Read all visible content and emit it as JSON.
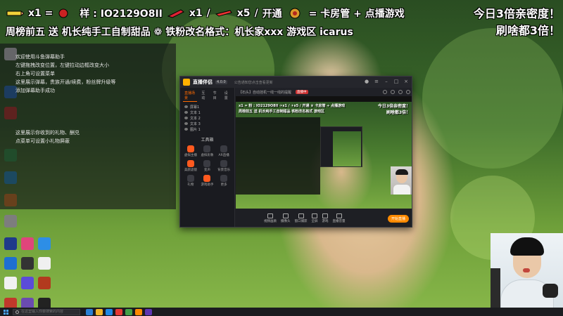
{
  "overlay": {
    "line1_prefix": "x1 = ",
    "line1_mid": "样 : IO2129O8II",
    "line1_x1": "x1",
    "line1_sep": "/",
    "line1_x5": "x5",
    "line1_sep2": "/",
    "line1_open": "开通",
    "line1_eq": "= 卡房管 + 点播游戏",
    "line2": "周榜前五 送 机长纯手工自制甜品 ❁ 铁粉改名格式：机长家xxx 游戏区 icarus"
  },
  "promo": {
    "line1": "今日3倍亲密度！",
    "line2": "刷啥都3倍！"
  },
  "chat_panel": {
    "lines": [
      "欢迎使用斗鱼弹幕助手",
      "左键拖拽改变位置，左键拉动边框改变大小",
      "右上角可设置菜单",
      "这里展示弹幕，贵族开通/续费，粉丝牌升级等",
      "添加弹幕助手成功",
      "这里展示你收到的礼物、酬兑",
      "点菜单可设置小礼物屏蔽"
    ]
  },
  "app": {
    "name": "直播伴侣",
    "version": "4.0.0",
    "notice": "公告通知您点击查看更新",
    "side_tabs": [
      "直播场景",
      "互动",
      "节目",
      "设置"
    ],
    "scenes": [
      "屏幕1",
      "文本 1",
      "文本 2",
      "文本 3",
      "图片 1"
    ],
    "tools_title": "工具箱",
    "tools": [
      {
        "label": "虚拟主播",
        "hot": true
      },
      {
        "label": "虚拟形象",
        "hot": false
      },
      {
        "label": "AR直播",
        "hot": false
      },
      {
        "label": "美颜滤镜",
        "hot": true
      },
      {
        "label": "变声",
        "hot": false
      },
      {
        "label": "背景音乐",
        "hot": false
      },
      {
        "label": "礼物",
        "hot": false
      },
      {
        "label": "游戏助手",
        "hot": true
      },
      {
        "label": "更多",
        "hot": false
      }
    ],
    "tab_title": "【石头】自动挂机一线一线的提醒",
    "tab_live": "直播中",
    "preview_line1": "x1 = 粉 : IO2129O8II ✈x1 / ✈x5 / 开通 ♛ 卡房管 + 点播游戏",
    "preview_line2": "周榜前五 送 机长纯手工自制甜品 铁粉改名格式 游戏区",
    "preview_promo1": "今日3倍亲密度！",
    "preview_promo2": "刷啥都3倍！",
    "bottom_tools": [
      "视频画质",
      "摄像头",
      "窗口捕获",
      "全屏",
      "游戏",
      "直播音量"
    ],
    "start_label": "开始直播"
  },
  "taskbar": {
    "search_placeholder": "在这里输入你要搜索的内容"
  },
  "colors": {
    "accent": "#ff8a00",
    "live_badge": "#cc3333"
  }
}
